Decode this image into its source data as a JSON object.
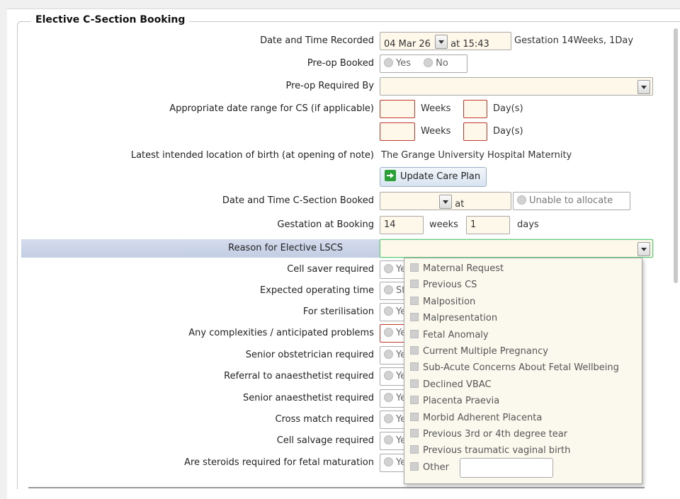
{
  "form": {
    "title": "Elective C-Section Booking",
    "labels": {
      "date_recorded": "Date and Time Recorded",
      "preop_booked": "Pre-op Booked",
      "preop_required_by": "Pre-op Required By",
      "date_range": "Appropriate date range for CS (if applicable)",
      "latest_location": "Latest intended location of birth (at opening of note)",
      "date_cs_booked": "Date and Time C-Section Booked",
      "gestation_booking": "Gestation at Booking",
      "reason": "Reason for Elective LSCS",
      "cell_saver": "Cell saver required",
      "operating_time": "Expected operating time",
      "sterilisation": "For sterilisation",
      "complexities": "Any complexities / anticipated problems",
      "senior_obstetrician": "Senior obstetrician required",
      "referral_anaesthetist": "Referral to anaesthetist required",
      "senior_anaesthetist": "Senior anaesthetist required",
      "cross_match": "Cross match required",
      "cell_salvage": "Cell salvage required",
      "steroids": "Are steroids required for fetal maturation"
    },
    "date_recorded": {
      "date": "04 Mar 26",
      "time": "at 15:43",
      "gestation": "Gestation 14Weeks, 1Day"
    },
    "preop_booked": {
      "yes": "Yes",
      "no": "No"
    },
    "date_range": {
      "weeks": "Weeks",
      "days": "Day(s)"
    },
    "location_value": "The Grange University Hospital Maternity",
    "update_button": "Update Care Plan",
    "cs_booked": {
      "at": "at",
      "unable": "Unable to allocate"
    },
    "gestation": {
      "weeks_value": "14",
      "weeks": "weeks",
      "days_value": "1",
      "days": "days"
    },
    "partial": {
      "ye": "Ye",
      "st": "St"
    }
  },
  "dropdown_options": [
    "Maternal Request",
    "Previous CS",
    "Malposition",
    "Malpresentation",
    "Fetal Anomaly",
    "Current Multiple Pregnancy",
    "Sub-Acute Concerns About Fetal Wellbeing",
    "Declined VBAC",
    "Placenta Praevia",
    "Morbid Adherent Placenta",
    "Previous 3rd or 4th degree tear",
    "Previous traumatic vaginal birth",
    "Other"
  ]
}
